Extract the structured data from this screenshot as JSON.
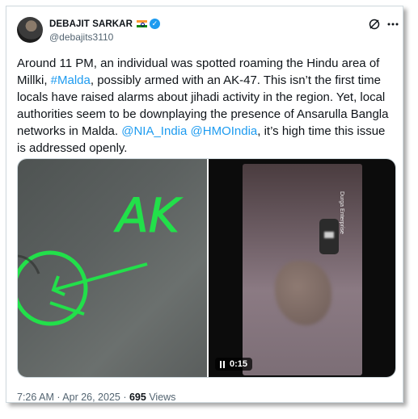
{
  "user": {
    "display_name": "DEBAJIT SARKAR",
    "handle": "@debajits3110",
    "flag_icon": "india-flag-icon",
    "verified_icon": "verified-badge-icon",
    "verified_color": "#1d9bf0"
  },
  "header_icons": {
    "grok": "grok-icon",
    "more": "more-icon"
  },
  "tweet": {
    "text_part1": "Around 11 PM, an individual was spotted roaming the Hindu  area of Millki, ",
    "hashtag": "#Malda",
    "text_part2": ", possibly armed with an AK-47. This isn’t the first time locals have raised alarms about jihadi activity in the region. Yet, local authorities seem to be downplaying the presence of Ansarulla Bangla networks in Malda. ",
    "mention1": "@NIA_India",
    "text_space": " ",
    "mention2": "@HMOIndia",
    "text_part3": ", it’s high time this issue is addressed openly."
  },
  "media": {
    "annotation_text": "AK",
    "annotation_color": "#22e04a",
    "watermark": "Durga Enterprise",
    "video_duration": "0:15"
  },
  "meta": {
    "time": "7:26 AM · Apr 26, 2025 · ",
    "views_count": "695",
    "views_label": " Views"
  },
  "colors": {
    "link": "#1d9bf0",
    "secondary_text": "#536471",
    "primary_text": "#0f1419",
    "border": "#cfd9de"
  }
}
